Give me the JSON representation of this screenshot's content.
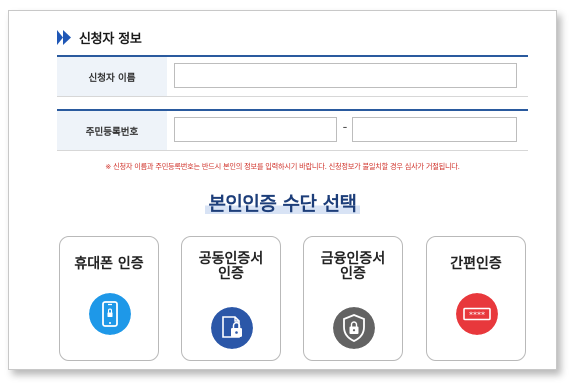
{
  "section": {
    "title": "신청자 정보"
  },
  "form": {
    "name_label": "신청자 이름",
    "name_value": "",
    "rrn_label": "주민등록번호",
    "rrn_front_value": "",
    "rrn_back_value": "",
    "rrn_separator": "-"
  },
  "notice": "※ 신청자 이름과 주민등록번호는 반드시 본인의 정보를 입력하시기 바랍니다. 신청정보가 불일치할 경우 심사가 거절됩니다.",
  "auth": {
    "title": "본인인증 수단 선택",
    "methods": [
      {
        "label": "휴대폰 인증",
        "icon": "mobile-phone-icon",
        "color": "#1e98e8"
      },
      {
        "label_line1": "공동인증서",
        "label_line2": "인증",
        "icon": "certificate-icon",
        "color": "#2b57a8"
      },
      {
        "label_line1": "금융인증서",
        "label_line2": "인증",
        "icon": "shield-lock-icon",
        "color": "#636363"
      },
      {
        "label": "간편인증",
        "icon": "pin-password-icon",
        "color": "#e8383c",
        "pin_mask": "****"
      }
    ]
  },
  "colors": {
    "accent_blue": "#1d3e7a",
    "table_border": "#2a5a9e",
    "label_bg": "#eef3f9",
    "notice_red": "#d0342c"
  }
}
